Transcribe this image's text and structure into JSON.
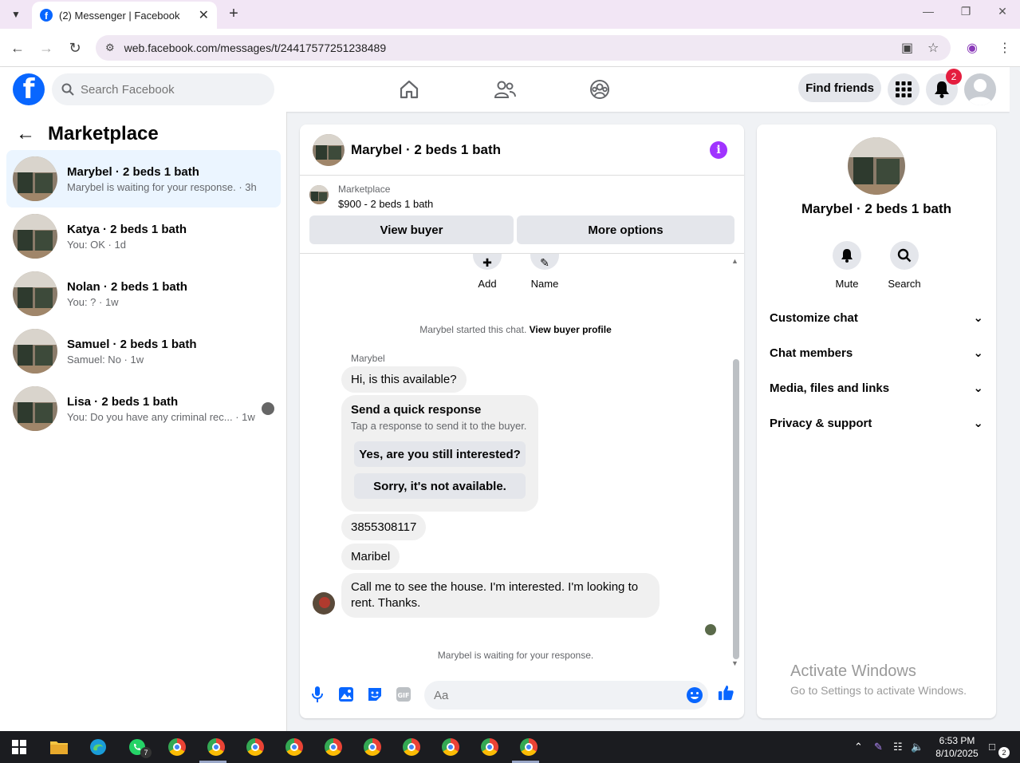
{
  "browser": {
    "tab_title": "(2) Messenger | Facebook",
    "url": "web.facebook.com/messages/t/24417577251238489"
  },
  "fb": {
    "search_placeholder": "Search Facebook",
    "find_friends": "Find friends",
    "notif_count": "2"
  },
  "left": {
    "title": "Marketplace",
    "conversations": [
      {
        "name": "Marybel · 2 beds 1 bath",
        "snippet": "Marybel is waiting for your response. · 3h"
      },
      {
        "name": "Katya · 2 beds 1 bath",
        "snippet": "You: OK · 1d"
      },
      {
        "name": "Nolan · 2 beds 1 bath",
        "snippet": "You: ? · 1w"
      },
      {
        "name": "Samuel · 2 beds 1 bath",
        "snippet": "Samuel: No · 1w"
      },
      {
        "name": "Lisa · 2 beds 1 bath",
        "snippet": "You: Do you have any criminal rec... · 1w"
      }
    ]
  },
  "chat": {
    "title": "Marybel · 2 beds 1 bath",
    "marketplace_label": "Marketplace",
    "listing": "$900 - 2 beds 1 bath",
    "view_buyer": "View buyer",
    "more_options": "More options",
    "add_label": "Add",
    "name_label": "Name",
    "started_text": "Marybel started this chat.",
    "view_profile": "View buyer profile",
    "sender": "Marybel",
    "msg1": "Hi, is this available?",
    "quick_title": "Send a quick response",
    "quick_sub": "Tap a response to send it to the buyer.",
    "quick_opt1": "Yes, are you still interested?",
    "quick_opt2": "Sorry, it's not available.",
    "msg2": "3855308117",
    "msg3": "Maribel",
    "msg4": "Call me to see the house. I'm interested. I'm looking to rent. Thanks.",
    "waiting": "Marybel is waiting for your response.",
    "input_placeholder": "Aa"
  },
  "right": {
    "name": "Marybel · 2 beds 1 bath",
    "mute": "Mute",
    "search": "Search",
    "rows": [
      "Customize chat",
      "Chat members",
      "Media, files and links",
      "Privacy & support"
    ]
  },
  "watermark": {
    "line1": "Activate Windows",
    "line2": "Go to Settings to activate Windows."
  },
  "taskbar": {
    "time": "6:53 PM",
    "date": "8/10/2025",
    "whatsapp_badge": "7",
    "action_badge": "2"
  }
}
